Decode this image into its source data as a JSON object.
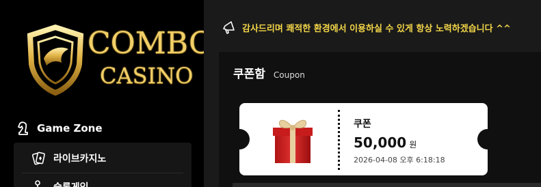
{
  "brand": {
    "line1": "COMBO",
    "line2": "CASINO"
  },
  "sidebar": {
    "section_title": "Game Zone",
    "items": [
      {
        "label": "라이브카지노",
        "icon": "cards-icon"
      },
      {
        "label": "슬롯게임",
        "icon": "slot-icon"
      }
    ]
  },
  "notice": {
    "text": "감사드리며 쾌적한 환경에서 이용하실 수 있게 항상 노력하겠습니다 ^^"
  },
  "coupon": {
    "heading_ko": "쿠폰함",
    "heading_en": "Coupon",
    "ticket": {
      "title": "쿠폰",
      "amount": "50,000",
      "unit": "원",
      "date": "2026-04-08 오후 6:18:18"
    }
  },
  "colors": {
    "gold": "#f1cf68",
    "notice_yellow": "#f3d648",
    "panel": "#1a1a1a"
  }
}
